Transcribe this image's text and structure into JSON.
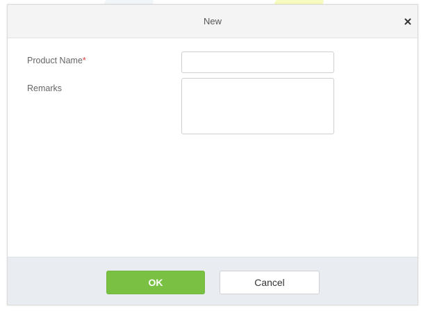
{
  "dialog": {
    "title": "New",
    "close_icon": "close-icon"
  },
  "form": {
    "product_name": {
      "label": "Product Name",
      "required_mark": "*",
      "value": "",
      "placeholder": ""
    },
    "remarks": {
      "label": "Remarks",
      "value": "",
      "placeholder": ""
    }
  },
  "footer": {
    "ok_label": "OK",
    "cancel_label": "Cancel"
  },
  "colors": {
    "ok_button": "#7ac143",
    "required_mark": "#e23d3d",
    "header_bg": "#f4f4f4",
    "footer_bg": "#e9ecf1"
  }
}
